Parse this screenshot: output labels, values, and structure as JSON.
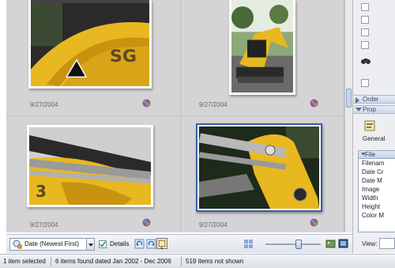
{
  "gallery": {
    "items": [
      {
        "date": "9/27/2004"
      },
      {
        "date": "9/27/2004"
      },
      {
        "date": "9/27/2004"
      },
      {
        "date": "9/27/2004"
      }
    ]
  },
  "right_panel": {
    "order_header": "Order",
    "properties_header": "Prop",
    "general_label": "General",
    "file_header": "File",
    "file_rows": [
      "Filenam",
      "Date Cr",
      "Date M",
      "Image",
      "Width",
      "Height",
      "Color M"
    ],
    "view_label": "View:"
  },
  "toolbar": {
    "sort_label": "Date (Newest First)",
    "details_label": "Details"
  },
  "status": {
    "selected": "1 item selected",
    "found": "6 items found dated Jan 2002 - Dec 2006",
    "not_shown": "519 items not shown"
  },
  "colors": {
    "accent": "#3a5ea8",
    "machine_yellow": "#e8b820"
  }
}
